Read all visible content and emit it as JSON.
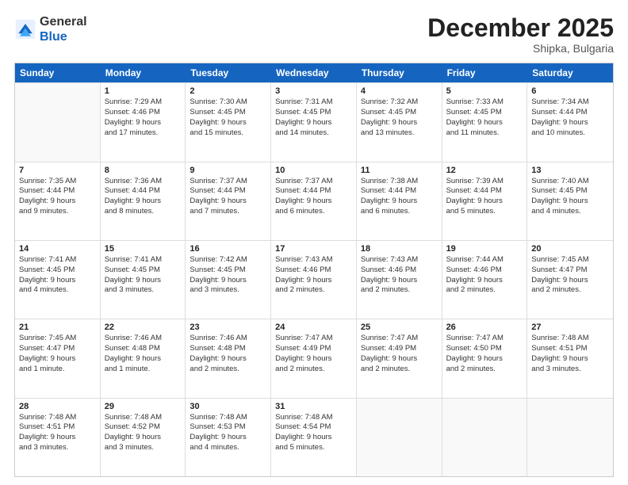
{
  "header": {
    "logo_general": "General",
    "logo_blue": "Blue",
    "month_title": "December 2025",
    "location": "Shipka, Bulgaria"
  },
  "weekdays": [
    "Sunday",
    "Monday",
    "Tuesday",
    "Wednesday",
    "Thursday",
    "Friday",
    "Saturday"
  ],
  "rows": [
    [
      {
        "day": "",
        "lines": []
      },
      {
        "day": "1",
        "lines": [
          "Sunrise: 7:29 AM",
          "Sunset: 4:46 PM",
          "Daylight: 9 hours",
          "and 17 minutes."
        ]
      },
      {
        "day": "2",
        "lines": [
          "Sunrise: 7:30 AM",
          "Sunset: 4:45 PM",
          "Daylight: 9 hours",
          "and 15 minutes."
        ]
      },
      {
        "day": "3",
        "lines": [
          "Sunrise: 7:31 AM",
          "Sunset: 4:45 PM",
          "Daylight: 9 hours",
          "and 14 minutes."
        ]
      },
      {
        "day": "4",
        "lines": [
          "Sunrise: 7:32 AM",
          "Sunset: 4:45 PM",
          "Daylight: 9 hours",
          "and 13 minutes."
        ]
      },
      {
        "day": "5",
        "lines": [
          "Sunrise: 7:33 AM",
          "Sunset: 4:45 PM",
          "Daylight: 9 hours",
          "and 11 minutes."
        ]
      },
      {
        "day": "6",
        "lines": [
          "Sunrise: 7:34 AM",
          "Sunset: 4:44 PM",
          "Daylight: 9 hours",
          "and 10 minutes."
        ]
      }
    ],
    [
      {
        "day": "7",
        "lines": [
          "Sunrise: 7:35 AM",
          "Sunset: 4:44 PM",
          "Daylight: 9 hours",
          "and 9 minutes."
        ]
      },
      {
        "day": "8",
        "lines": [
          "Sunrise: 7:36 AM",
          "Sunset: 4:44 PM",
          "Daylight: 9 hours",
          "and 8 minutes."
        ]
      },
      {
        "day": "9",
        "lines": [
          "Sunrise: 7:37 AM",
          "Sunset: 4:44 PM",
          "Daylight: 9 hours",
          "and 7 minutes."
        ]
      },
      {
        "day": "10",
        "lines": [
          "Sunrise: 7:37 AM",
          "Sunset: 4:44 PM",
          "Daylight: 9 hours",
          "and 6 minutes."
        ]
      },
      {
        "day": "11",
        "lines": [
          "Sunrise: 7:38 AM",
          "Sunset: 4:44 PM",
          "Daylight: 9 hours",
          "and 6 minutes."
        ]
      },
      {
        "day": "12",
        "lines": [
          "Sunrise: 7:39 AM",
          "Sunset: 4:44 PM",
          "Daylight: 9 hours",
          "and 5 minutes."
        ]
      },
      {
        "day": "13",
        "lines": [
          "Sunrise: 7:40 AM",
          "Sunset: 4:45 PM",
          "Daylight: 9 hours",
          "and 4 minutes."
        ]
      }
    ],
    [
      {
        "day": "14",
        "lines": [
          "Sunrise: 7:41 AM",
          "Sunset: 4:45 PM",
          "Daylight: 9 hours",
          "and 4 minutes."
        ]
      },
      {
        "day": "15",
        "lines": [
          "Sunrise: 7:41 AM",
          "Sunset: 4:45 PM",
          "Daylight: 9 hours",
          "and 3 minutes."
        ]
      },
      {
        "day": "16",
        "lines": [
          "Sunrise: 7:42 AM",
          "Sunset: 4:45 PM",
          "Daylight: 9 hours",
          "and 3 minutes."
        ]
      },
      {
        "day": "17",
        "lines": [
          "Sunrise: 7:43 AM",
          "Sunset: 4:46 PM",
          "Daylight: 9 hours",
          "and 2 minutes."
        ]
      },
      {
        "day": "18",
        "lines": [
          "Sunrise: 7:43 AM",
          "Sunset: 4:46 PM",
          "Daylight: 9 hours",
          "and 2 minutes."
        ]
      },
      {
        "day": "19",
        "lines": [
          "Sunrise: 7:44 AM",
          "Sunset: 4:46 PM",
          "Daylight: 9 hours",
          "and 2 minutes."
        ]
      },
      {
        "day": "20",
        "lines": [
          "Sunrise: 7:45 AM",
          "Sunset: 4:47 PM",
          "Daylight: 9 hours",
          "and 2 minutes."
        ]
      }
    ],
    [
      {
        "day": "21",
        "lines": [
          "Sunrise: 7:45 AM",
          "Sunset: 4:47 PM",
          "Daylight: 9 hours",
          "and 1 minute."
        ]
      },
      {
        "day": "22",
        "lines": [
          "Sunrise: 7:46 AM",
          "Sunset: 4:48 PM",
          "Daylight: 9 hours",
          "and 1 minute."
        ]
      },
      {
        "day": "23",
        "lines": [
          "Sunrise: 7:46 AM",
          "Sunset: 4:48 PM",
          "Daylight: 9 hours",
          "and 2 minutes."
        ]
      },
      {
        "day": "24",
        "lines": [
          "Sunrise: 7:47 AM",
          "Sunset: 4:49 PM",
          "Daylight: 9 hours",
          "and 2 minutes."
        ]
      },
      {
        "day": "25",
        "lines": [
          "Sunrise: 7:47 AM",
          "Sunset: 4:49 PM",
          "Daylight: 9 hours",
          "and 2 minutes."
        ]
      },
      {
        "day": "26",
        "lines": [
          "Sunrise: 7:47 AM",
          "Sunset: 4:50 PM",
          "Daylight: 9 hours",
          "and 2 minutes."
        ]
      },
      {
        "day": "27",
        "lines": [
          "Sunrise: 7:48 AM",
          "Sunset: 4:51 PM",
          "Daylight: 9 hours",
          "and 3 minutes."
        ]
      }
    ],
    [
      {
        "day": "28",
        "lines": [
          "Sunrise: 7:48 AM",
          "Sunset: 4:51 PM",
          "Daylight: 9 hours",
          "and 3 minutes."
        ]
      },
      {
        "day": "29",
        "lines": [
          "Sunrise: 7:48 AM",
          "Sunset: 4:52 PM",
          "Daylight: 9 hours",
          "and 3 minutes."
        ]
      },
      {
        "day": "30",
        "lines": [
          "Sunrise: 7:48 AM",
          "Sunset: 4:53 PM",
          "Daylight: 9 hours",
          "and 4 minutes."
        ]
      },
      {
        "day": "31",
        "lines": [
          "Sunrise: 7:48 AM",
          "Sunset: 4:54 PM",
          "Daylight: 9 hours",
          "and 5 minutes."
        ]
      },
      {
        "day": "",
        "lines": []
      },
      {
        "day": "",
        "lines": []
      },
      {
        "day": "",
        "lines": []
      }
    ]
  ]
}
